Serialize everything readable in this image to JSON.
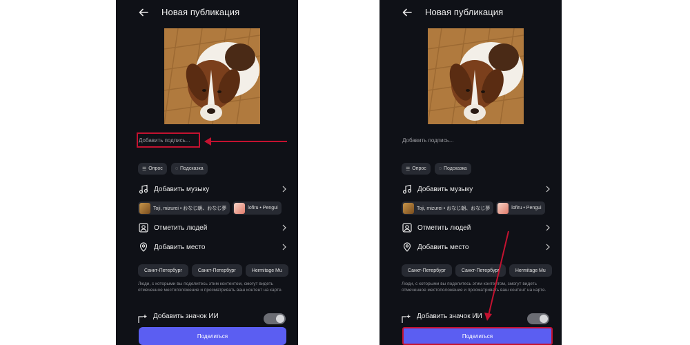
{
  "screens": [
    {
      "header": {
        "title": "Новая публикация"
      },
      "caption": {
        "placeholder": "Добавить подпись..."
      },
      "chips": {
        "poll": "Опрос",
        "hint": "Подсказка"
      },
      "rows": {
        "music": "Добавить музыку",
        "tag_people": "Отметить людей",
        "add_place": "Добавить место"
      },
      "music_suggestions": [
        "Toji, mizurei • おなじ朝、おなじ夢",
        "lofiru • Pengui"
      ],
      "places": [
        "Санкт-Петербург",
        "Санкт-Петербург",
        "Hermitage Mu"
      ],
      "note": "Люди, с которыми вы поделитесь этим контентом, смогут видеть отмеченное местоположение и просматривать ваш контент на карте.",
      "ai_label": {
        "label": "Добавить значок ИИ",
        "enabled": false
      },
      "share_button": "Поделиться"
    },
    {
      "header": {
        "title": "Новая публикация"
      },
      "caption": {
        "placeholder": "Добавить подпись..."
      },
      "chips": {
        "poll": "Опрос",
        "hint": "Подсказка"
      },
      "rows": {
        "music": "Добавить музыку",
        "tag_people": "Отметить людей",
        "add_place": "Добавить место"
      },
      "music_suggestions": [
        "Toji, mizurei • おなじ朝、おなじ夢",
        "lofiru • Pengui"
      ],
      "places": [
        "Санкт-Петербург",
        "Санкт-Петербург",
        "Hermitage Mu"
      ],
      "note": "Люди, с которыми вы поделитесь этим контентом, смогут видеть отмеченное местоположение и просматривать ваш контент на карте.",
      "ai_label": {
        "label": "Добавить значок ИИ",
        "enabled": false
      },
      "share_button": "Поделиться"
    }
  ],
  "colors": {
    "background": "#0f1117",
    "chip": "#272a32",
    "accent": "#5b5ef2",
    "annotation": "#c41230"
  },
  "icons": [
    "back-arrow-icon",
    "poll-icon",
    "hint-icon",
    "music-note-icon",
    "tag-people-icon",
    "location-pin-icon",
    "chevron-right-icon",
    "ai-label-icon"
  ]
}
